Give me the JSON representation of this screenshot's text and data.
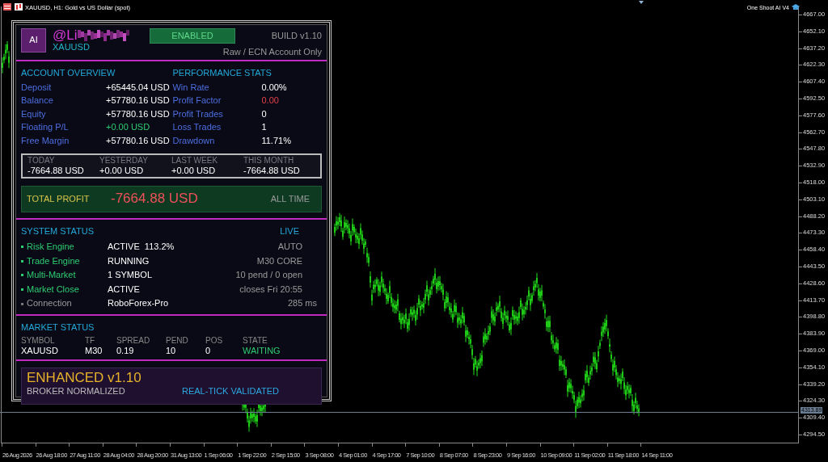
{
  "chart_header": {
    "title": "XAUUSD, H1:  Gold vs US Dollar (spot)",
    "expert": "One Shoot AI V4"
  },
  "panel": {
    "logo": "AI",
    "name": "@Li",
    "symbol": "XAUUSD",
    "status_badge": "ENABLED",
    "build": "BUILD v1.10",
    "account_note": "Raw / ECN Account Only",
    "account_overview": {
      "title": "ACCOUNT OVERVIEW",
      "rows": [
        {
          "label": "Deposit",
          "value": "+65445.04 USD",
          "gain": false
        },
        {
          "label": "Balance",
          "value": "+57780.16 USD",
          "gain": false
        },
        {
          "label": "Equity",
          "value": "+57780.16 USD",
          "gain": false
        },
        {
          "label": "Floating P/L",
          "value": "+0.00 USD",
          "gain": true
        },
        {
          "label": "Free Margin",
          "value": "+57780.16 USD",
          "gain": false
        }
      ]
    },
    "performance_stats": {
      "title": "PERFORMANCE STATS",
      "rows": [
        {
          "label": "Win Rate",
          "value": "0.00%",
          "alert": false
        },
        {
          "label": "Profit Factor",
          "value": "0.00",
          "alert": true
        },
        {
          "label": "Profit Trades",
          "value": "0",
          "alert": false
        },
        {
          "label": "Loss Trades",
          "value": "1",
          "alert": false
        },
        {
          "label": "Drawdown",
          "value": "11.71%",
          "alert": false
        }
      ]
    },
    "periods": [
      {
        "label": "TODAY",
        "value": "-7664.88 USD"
      },
      {
        "label": "YESTERDAY",
        "value": "+0.00 USD"
      },
      {
        "label": "LAST WEEK",
        "value": "+0.00 USD"
      },
      {
        "label": "THIS MONTH",
        "value": "-7664.88 USD"
      }
    ],
    "total_profit": {
      "label": "TOTAL PROFIT",
      "value": "-7664.88 USD",
      "scope": "ALL TIME"
    },
    "system_status": {
      "title": "SYSTEM STATUS",
      "mode": "LIVE",
      "rows": [
        {
          "label": "Risk Engine",
          "value": "ACTIVE  113.2%",
          "detail": "AUTO",
          "active": true
        },
        {
          "label": "Trade Engine",
          "value": "RUNNING",
          "detail": "M30 CORE",
          "active": true
        },
        {
          "label": "Multi-Market",
          "value": "1 SYMBOL",
          "detail": "10 pend / 0 open",
          "active": true
        },
        {
          "label": "Market Close",
          "value": "ACTIVE",
          "detail": "closes Fri 20:55",
          "active": true
        },
        {
          "label": "Connection",
          "value": "RoboForex-Pro",
          "detail": "285 ms",
          "active": false
        }
      ]
    },
    "market_status": {
      "title": "MARKET STATUS",
      "columns": [
        "SYMBOL",
        "TF",
        "SPREAD",
        "PEND",
        "POS",
        "STATE"
      ],
      "rows": [
        {
          "cells": [
            "XAUUSD",
            "M30",
            "0.19",
            "10",
            "0",
            "WAITING"
          ],
          "state_ok": true
        }
      ]
    },
    "footer": {
      "title": "ENHANCED v1.10",
      "left": "BROKER NORMALIZED",
      "right": "REAL-TICK VALIDATED"
    }
  },
  "price_axis": [
    "4667.00",
    "4652.10",
    "4637.20",
    "4622.30",
    "4607.40",
    "4592.50",
    "4577.60",
    "4562.70",
    "4547.80",
    "4532.90",
    "4518.00",
    "4503.10",
    "4488.20",
    "4473.30",
    "4458.40",
    "4443.50",
    "4428.60",
    "4413.70",
    "4398.80",
    "4383.90",
    "4369.00",
    "4354.10",
    "4339.20",
    "4324.30",
    "4309.40",
    "4294.50"
  ],
  "current_price": "4313.89",
  "time_axis": [
    "26 Aug 2026",
    "26 Aug 18:00",
    "27 Aug 11:00",
    "28 Aug 04:00",
    "28 Aug 20:00",
    "31 Aug 13:00",
    "1 Sep 06:00",
    "1 Sep 22:00",
    "2 Sep 15:00",
    "3 Sep 08:00",
    "4 Sep 01:00",
    "4 Sep 17:00",
    "7 Sep 10:00",
    "8 Sep 07:00",
    "8 Sep 23:00",
    "9 Sep 16:00",
    "10 Sep 09:00",
    "11 Sep 02:00",
    "11 Sep 18:00",
    "14 Sep 11:00"
  ]
}
